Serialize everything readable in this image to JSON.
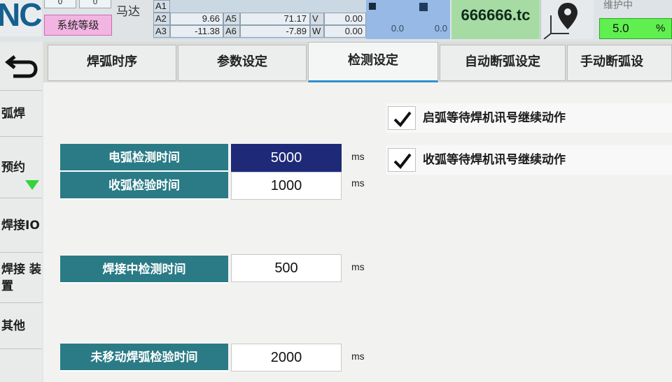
{
  "header": {
    "logo_text": "NC",
    "mini_cells": [
      "0",
      "0"
    ],
    "level_label": "系统等级",
    "motor_label": "马达",
    "axes": [
      {
        "name": "A2",
        "value": "9.66",
        "name2": "A5",
        "value2": "71.17",
        "unit": "V",
        "extra": "0.00"
      },
      {
        "name": "A3",
        "value": "-11.38",
        "name2": "A6",
        "value2": "-7.89",
        "unit": "W",
        "extra": "0.00"
      }
    ],
    "speed_values": [
      "0.0",
      "0.0"
    ],
    "program_name": "666666.tc",
    "location_icon": "map-pin-axes-icon",
    "status_text": "维护中",
    "progress_value": "5.0",
    "progress_unit": "%"
  },
  "sidebar": {
    "back_icon": "undo-arrow-icon",
    "items": [
      {
        "label": "弧焊"
      },
      {
        "label": "预约"
      },
      {
        "label": "焊接IO"
      },
      {
        "label": "焊接 装置"
      },
      {
        "label": "其他"
      }
    ]
  },
  "tabs": [
    {
      "label": "焊弧时序",
      "active": false
    },
    {
      "label": "参数设定",
      "active": false
    },
    {
      "label": "检测设定",
      "active": true
    },
    {
      "label": "自动断弧设定",
      "active": false
    },
    {
      "label": "手动断弧设"
    }
  ],
  "params": [
    {
      "label": "电弧检测时间",
      "value": "5000",
      "unit": "ms",
      "selected": true
    },
    {
      "label": "收弧检验时间",
      "value": "1000",
      "unit": "ms",
      "selected": false
    },
    {
      "label": "焊接中检测时间",
      "value": "500",
      "unit": "ms",
      "selected": false
    },
    {
      "label": "未移动焊弧检验时间",
      "value": "2000",
      "unit": "ms",
      "selected": false
    }
  ],
  "checkboxes": [
    {
      "label": "启弧等待焊机讯号继续动作",
      "checked": true
    },
    {
      "label": "收弧等待焊机讯号继续动作",
      "checked": true
    }
  ],
  "colors": {
    "accent": "#2e8fcf",
    "label_bg": "#2a7b86",
    "selected_bg": "#1e2a78",
    "progress_green": "#5ff04f",
    "program_green": "#a6dca4",
    "level_pink": "#f2b5e3"
  }
}
